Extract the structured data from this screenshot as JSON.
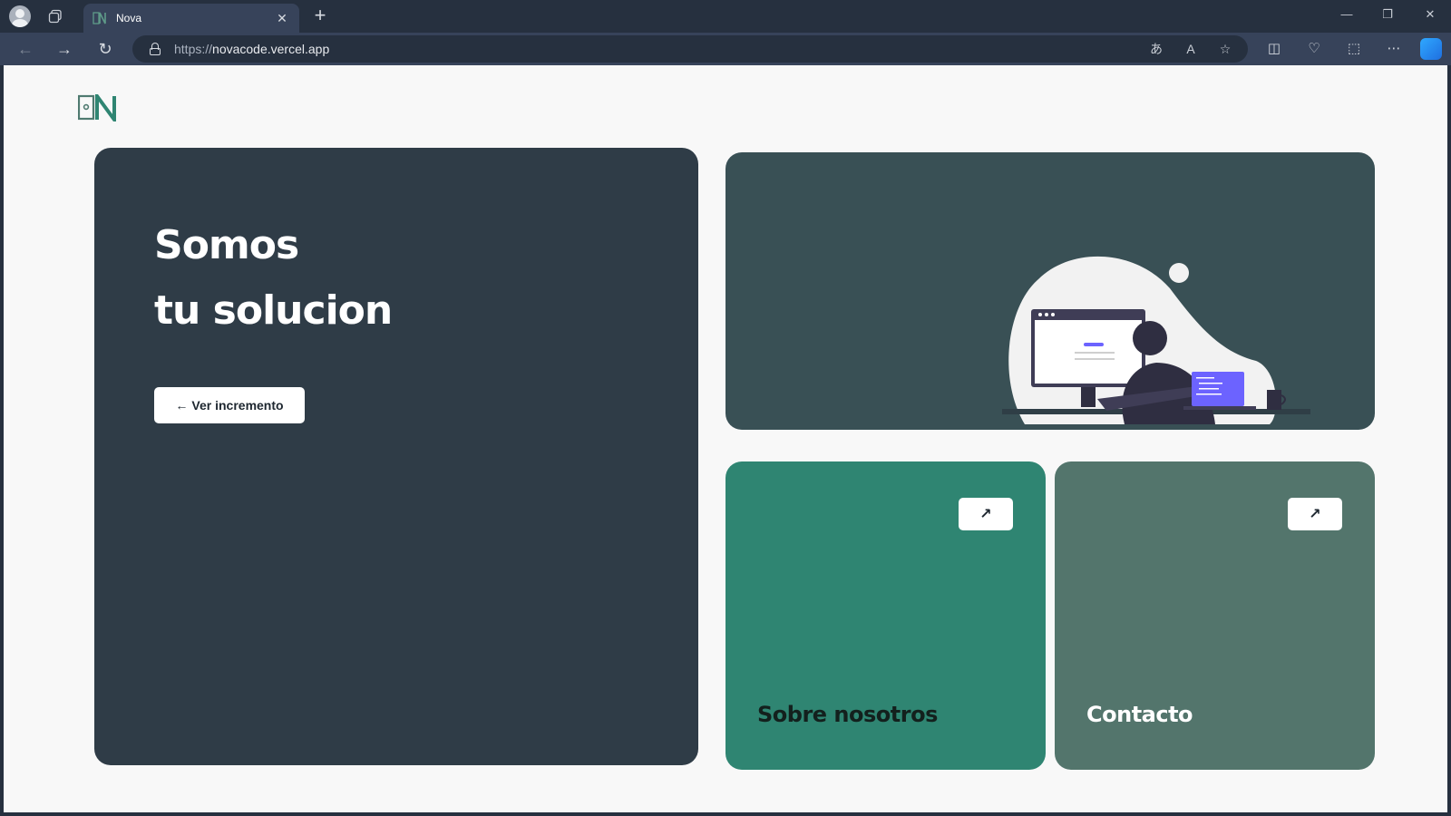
{
  "browser": {
    "tab": {
      "title": "Nova"
    },
    "url": {
      "protocol": "https://",
      "host": "novacode.vercel.app"
    },
    "icons": {
      "profile": "profile-icon",
      "workspaces": "workspaces-icon",
      "back": "back-arrow-icon",
      "forward": "forward-arrow-icon",
      "reload": "reload-icon",
      "translate": "translate-icon",
      "read_aloud": "read-aloud-icon",
      "favorite": "star-icon",
      "split": "split-screen-icon",
      "health": "browser-essentials-icon",
      "screenshot": "screenshot-icon",
      "more": "more-icon",
      "copilot": "copilot-icon"
    }
  },
  "hero": {
    "line1": "Somos",
    "line2": "tu solucion",
    "button_label": "Ver incremento",
    "button_arrow": "←"
  },
  "cards": {
    "about": {
      "label": "Sobre nosotros",
      "arrow": "↗"
    },
    "contact": {
      "label": "Contacto",
      "arrow": "↗"
    }
  },
  "colors": {
    "hero_bg": "#2f3c47",
    "image_card_bg": "#395055",
    "about_bg": "#2f8572",
    "contact_bg": "#53756c",
    "page_bg": "#f8f8f8",
    "illustration_accent": "#6c63ff"
  }
}
